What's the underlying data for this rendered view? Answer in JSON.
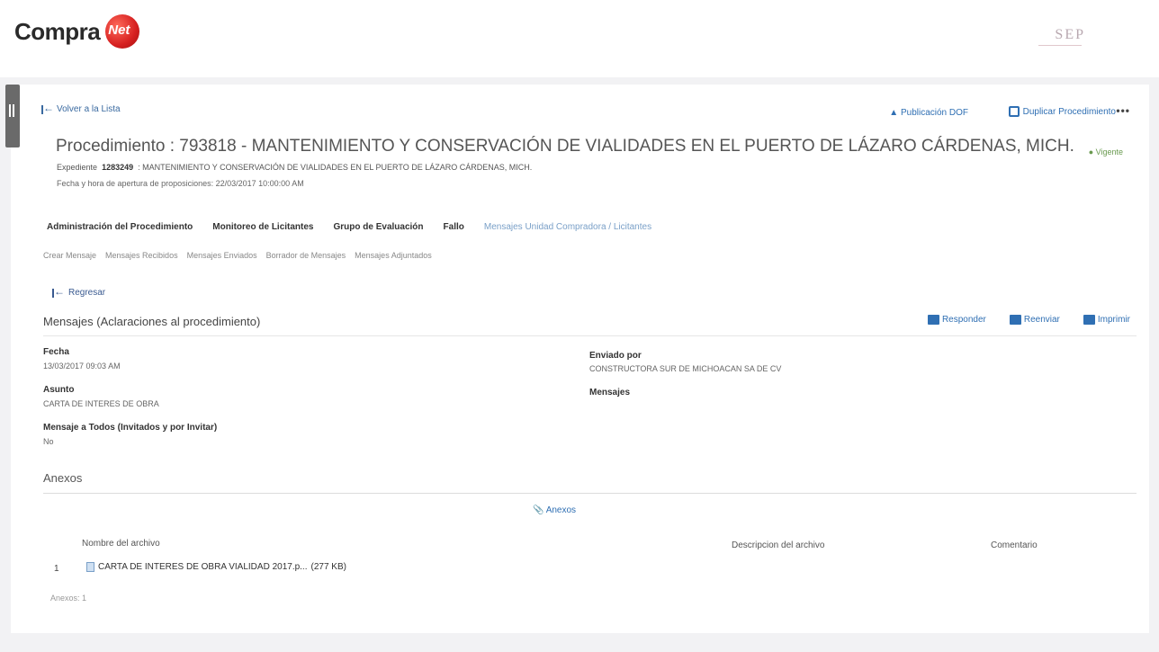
{
  "brand": {
    "logo_text": "Compra",
    "logo_net": "Net",
    "org_logo": "SEP"
  },
  "nav": {
    "back_to_list": "Volver a la Lista",
    "publicacion_dof": "Publicación DOF",
    "duplicar": "Duplicar Procedimiento",
    "more": "•••"
  },
  "procedure": {
    "title": "Procedimiento : 793818 - MANTENIMIENTO Y CONSERVACIÓN DE VIALIDADES EN EL PUERTO DE LÁZARO CÁRDENAS, MICH.",
    "status": "Vigente",
    "expediente_label": "Expediente",
    "expediente_num": "1283249",
    "expediente_desc": ": MANTENIMIENTO Y CONSERVACIÓN DE VIALIDADES EN EL PUERTO DE LÁZARO CÁRDENAS, MICH.",
    "fecha_apertura": "Fecha y hora de apertura de proposiciones: 22/03/2017 10:00:00 AM"
  },
  "tabs": [
    "Administración del Procedimiento",
    "Monitoreo de Licitantes",
    "Grupo de Evaluación",
    "Fallo",
    "Mensajes Unidad Compradora / Licitantes"
  ],
  "subtabs": [
    "Crear Mensaje",
    "Mensajes Recibidos",
    "Mensajes Enviados",
    "Borrador de Mensajes",
    "Mensajes Adjuntados"
  ],
  "message": {
    "back": "Regresar",
    "title": "Mensajes (Aclaraciones al procedimiento)",
    "actions": {
      "reply": "Responder",
      "forward": "Reenviar",
      "print": "Imprimir"
    },
    "fecha_label": "Fecha",
    "fecha_value": "13/03/2017 09:03 AM",
    "asunto_label": "Asunto",
    "asunto_value": "CARTA DE INTERES DE OBRA",
    "todos_label": "Mensaje a Todos (Invitados y por Invitar)",
    "todos_value": "No",
    "enviado_label": "Enviado por",
    "enviado_value": "CONSTRUCTORA SUR DE MICHOACAN SA DE CV",
    "mensajes_label": "Mensajes"
  },
  "annexes": {
    "title": "Anexos",
    "link": "Anexos",
    "columns": {
      "name": "Nombre del archivo",
      "description": "Descripcion del archivo",
      "comment": "Comentario"
    },
    "rows": [
      {
        "num": "1",
        "file": "CARTA DE INTERES DE OBRA VIALIDAD 2017.p...",
        "size": "(277 KB)"
      }
    ],
    "count": "Anexos: 1"
  }
}
